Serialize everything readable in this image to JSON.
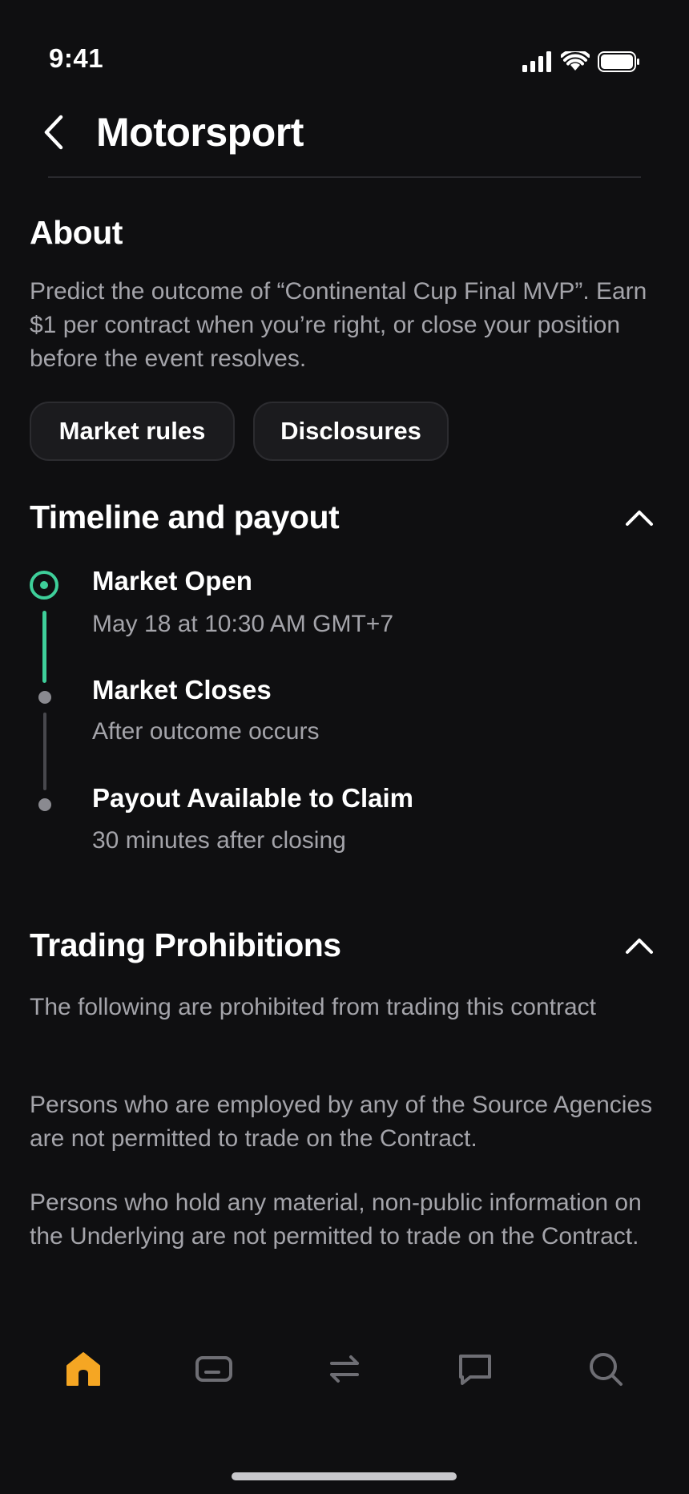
{
  "status_bar": {
    "time": "9:41"
  },
  "header": {
    "title": "Motorsport"
  },
  "about": {
    "heading": "About",
    "description": "Predict the outcome of “Continental Cup Final MVP”. Earn $1 per contract when you’re right, or close your position before the event resolves.",
    "buttons": {
      "market_rules": "Market rules",
      "disclosures": "Disclosures"
    }
  },
  "timeline": {
    "heading": "Timeline and payout",
    "items": [
      {
        "title": "Market Open",
        "subtitle": "May 18 at 10:30 AM GMT+7"
      },
      {
        "title": "Market Closes",
        "subtitle": "After outcome occurs"
      },
      {
        "title": "Payout Available to Claim",
        "subtitle": "30 minutes after closing"
      }
    ]
  },
  "prohibitions": {
    "heading": "Trading Prohibitions",
    "paragraphs": [
      "The following are prohibited from trading this contract",
      "Persons who are employed by any of the Source Agencies are not permitted to trade on the Contract.",
      "Persons who hold any material, non-public information on the Underlying are not permitted to trade on the Contract."
    ]
  },
  "tab_bar": {
    "items": [
      "home-icon",
      "card-icon",
      "transfer-icon",
      "chat-icon",
      "search-icon"
    ],
    "active": "home-icon",
    "active_color": "#f5a623",
    "inactive_color": "#6e6e74"
  },
  "colors": {
    "accent_green": "#3ecf9a",
    "background": "#0f0f11"
  }
}
